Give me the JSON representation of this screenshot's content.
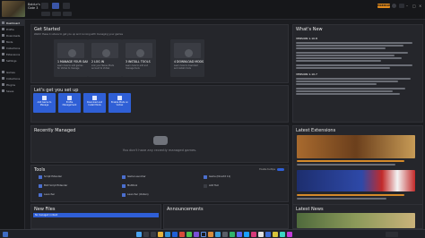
{
  "app": {
    "game_name_line1": "Baldur's",
    "game_name_line2": "Gate 3",
    "premium_label": "PREMIUM"
  },
  "sidebar": {
    "items": [
      {
        "label": "Dashboard",
        "active": true
      },
      {
        "label": "Profile"
      },
      {
        "label": "Downloads"
      },
      {
        "label": "Mods"
      },
      {
        "label": "Collections"
      },
      {
        "label": "Extensions"
      },
      {
        "label": "Settings"
      }
    ],
    "section2": [
      {
        "label": "Games"
      },
      {
        "label": "Collections"
      },
      {
        "label": "Plugins"
      },
      {
        "label": "Saves"
      }
    ]
  },
  "get_started": {
    "title": "Get Started",
    "subtitle": "Watch these 4 videos to get you up and running with managing your games",
    "cards": [
      {
        "num": "1  MANAGE YOUR GAME",
        "desc": "Learn how to add games for Vortex to manage"
      },
      {
        "num": "2  LOG IN",
        "desc": "Link your Nexus Mods account to Vortex"
      },
      {
        "num": "3  INSTALL TOOLS",
        "desc": "Learn how to add and manage tools"
      },
      {
        "num": "4  DOWNLOAD MODS",
        "desc": "Learn how to download and install mods"
      }
    ]
  },
  "set_up": {
    "title": "Let's get you set up",
    "buttons": [
      {
        "label": "Add Game to Manage"
      },
      {
        "label": "Profile Management"
      },
      {
        "label": "Download and Install Mods"
      },
      {
        "label": "Enable Mods on Vortex"
      }
    ]
  },
  "whats_new": {
    "title": "What's New",
    "v1": "VERSION 1.10.8",
    "v2": "VERSION 1.10.7"
  },
  "recently_managed": {
    "title": "Recently Managed",
    "empty_text": "You don't have any recently managed games."
  },
  "latest_extensions": {
    "title": "Latest Extensions"
  },
  "tools": {
    "title": "Tools",
    "enable_label": "Enable tooltips",
    "items": [
      {
        "label": "Script Extender"
      },
      {
        "label": "BG3 Script Extender"
      },
      {
        "label": "Launcher"
      },
      {
        "label": "Game Launcher"
      },
      {
        "label": "Multitool"
      },
      {
        "label": "Launcher (Vulkan)"
      },
      {
        "label": "Game (DirectX 11)"
      },
      {
        "label": "Add Tool"
      }
    ]
  },
  "new_files": {
    "title": "New Files",
    "row": "No managed content"
  },
  "announcements": {
    "title": "Announcements"
  },
  "latest_news": {
    "title": "Latest News"
  },
  "colors": {
    "accent_blue": "#2f5fd6",
    "premium_orange": "#e08a1e",
    "panel_bg": "#25262b"
  }
}
